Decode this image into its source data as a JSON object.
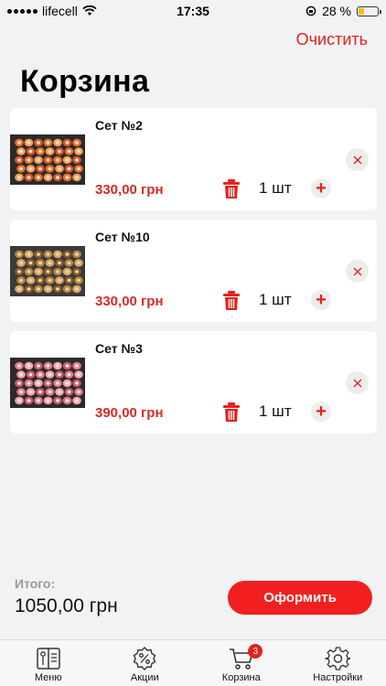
{
  "status_bar": {
    "carrier": "lifecell",
    "time": "17:35",
    "battery": "28 %",
    "battery_color": "#f5c200"
  },
  "header": {
    "clear_label": "Очистить",
    "title": "Корзина"
  },
  "cart": {
    "items": [
      {
        "name": "Сет №2",
        "price": "330,00 грн",
        "quantity": "1 шт",
        "image": "sushi-set-image"
      },
      {
        "name": "Сет №10",
        "price": "330,00 грн",
        "quantity": "1 шт",
        "image": "sushi-set-image"
      },
      {
        "name": "Сет №3",
        "price": "390,00 грн",
        "quantity": "1 шт",
        "image": "sushi-set-image"
      }
    ]
  },
  "summary": {
    "total_label": "Итого:",
    "total_value": "1050,00 грн",
    "checkout_label": "Оформить"
  },
  "tab_bar": {
    "tabs": [
      {
        "label": "Меню",
        "icon": "menu-book-icon"
      },
      {
        "label": "Акции",
        "icon": "discount-badge-icon"
      },
      {
        "label": "Корзина",
        "icon": "cart-icon",
        "badge": "3"
      },
      {
        "label": "Настройки",
        "icon": "gear-icon"
      }
    ]
  },
  "colors": {
    "accent": "#e2231a",
    "checkout_button": "#f31f1f",
    "price": "#d92a22",
    "background": "#f2f2f4"
  }
}
